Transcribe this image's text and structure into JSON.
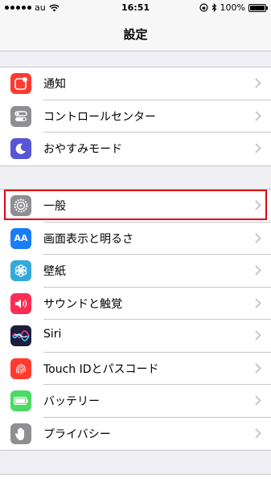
{
  "status": {
    "carrier": "au",
    "time": "16:51",
    "battery_pct": "100%",
    "battery_level": 1.0
  },
  "nav": {
    "title": "設定"
  },
  "groups": [
    {
      "items": [
        {
          "label": "通知",
          "icon": "notifications-icon",
          "color": "#fe3b30"
        },
        {
          "label": "コントロールセンター",
          "icon": "control-center-icon",
          "color": "#8e8e93"
        },
        {
          "label": "おやすみモード",
          "icon": "moon-icon",
          "color": "#5856d6"
        }
      ]
    },
    {
      "items": [
        {
          "label": "一般",
          "icon": "gear-icon",
          "color": "#8e8e93"
        },
        {
          "label": "画面表示と明るさ",
          "icon": "display-brightness-icon",
          "color": "#1a7cf7",
          "glyph": "AA"
        },
        {
          "label": "壁紙",
          "icon": "wallpaper-flower-icon",
          "color": "#34aadc"
        },
        {
          "label": "サウンドと触覚",
          "icon": "speaker-icon",
          "color": "#ff2d55"
        },
        {
          "label": "Siri",
          "icon": "siri-icon",
          "color": "#1d1d3d"
        },
        {
          "label": "Touch IDとパスコード",
          "icon": "fingerprint-icon",
          "color": "#ff3b30"
        },
        {
          "label": "バッテリー",
          "icon": "battery-icon",
          "color": "#4cd964"
        },
        {
          "label": "プライバシー",
          "icon": "hand-icon",
          "color": "#8e8e93"
        }
      ]
    }
  ],
  "colors": {
    "highlight": "#e60012",
    "background": "#efeff4",
    "chevron": "#c7c7cc"
  }
}
